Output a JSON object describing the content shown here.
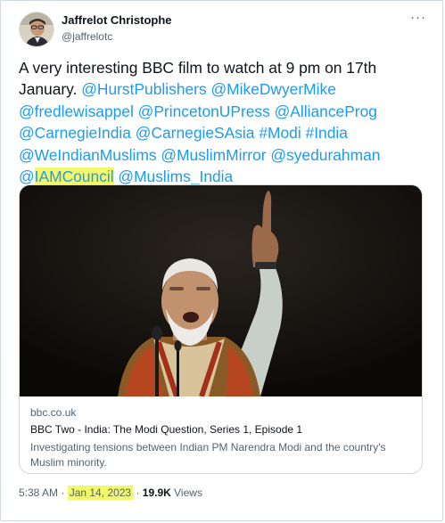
{
  "author": {
    "name": "Jaffrelot Christophe",
    "handle": "@jaffrelotc"
  },
  "more_icon": "more-horizontal-icon",
  "tweet": {
    "segments": [
      {
        "text": "A very interesting BBC film to watch at 9 pm on 17th January. ",
        "type": "text"
      },
      {
        "text": "@HurstPublishers",
        "type": "link"
      },
      {
        "text": " ",
        "type": "text"
      },
      {
        "text": "@MikeDwyerMike",
        "type": "link"
      },
      {
        "text": " ",
        "type": "text"
      },
      {
        "text": "@fredlewisappel",
        "type": "link"
      },
      {
        "text": " ",
        "type": "text"
      },
      {
        "text": "@PrincetonUPress",
        "type": "link"
      },
      {
        "text": " ",
        "type": "text"
      },
      {
        "text": "@AllianceProg",
        "type": "link"
      },
      {
        "text": " ",
        "type": "text"
      },
      {
        "text": "@CarnegieIndia",
        "type": "link"
      },
      {
        "text": " ",
        "type": "text"
      },
      {
        "text": "@CarnegieSAsia",
        "type": "link"
      },
      {
        "text": " ",
        "type": "text"
      },
      {
        "text": "#Modi",
        "type": "link"
      },
      {
        "text": " ",
        "type": "text"
      },
      {
        "text": "#India",
        "type": "link"
      },
      {
        "text": " ",
        "type": "text"
      },
      {
        "text": "@WeIndianMuslims",
        "type": "link"
      },
      {
        "text": " ",
        "type": "text"
      },
      {
        "text": "@MuslimMirror",
        "type": "link"
      },
      {
        "text": " ",
        "type": "text"
      },
      {
        "text": "@syedurahman",
        "type": "link"
      },
      {
        "text": " ",
        "type": "text"
      },
      {
        "text": "@",
        "type": "link-hl-at"
      },
      {
        "text": "IAMCouncil",
        "type": "link-hl"
      },
      {
        "text": " ",
        "type": "text"
      },
      {
        "text": "@Muslims_India",
        "type": "link"
      }
    ]
  },
  "card": {
    "domain": "bbc.co.uk",
    "title": "BBC Two - India: The Modi Question, Series 1, Episode 1",
    "description": "Investigating tensions between Indian PM Narendra Modi and the country's Muslim minority."
  },
  "meta": {
    "time": "5:38 AM",
    "sep1": " · ",
    "date": "Jan 14, 2023",
    "sep2": " · ",
    "views_count": "19.9K",
    "views_label": " Views"
  },
  "colors": {
    "link": "#1d9bf0",
    "highlight": "#f3f86a",
    "muted": "#536471",
    "text": "#0f1419",
    "border": "#cfd9de"
  }
}
